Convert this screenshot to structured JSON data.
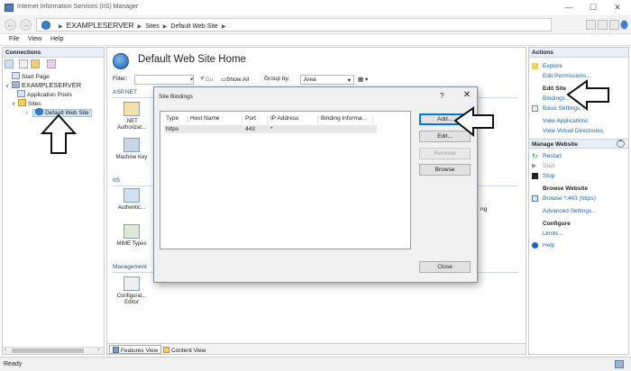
{
  "window": {
    "title": "Internet Information Services (IIS) Manager",
    "controls": [
      "—",
      "☐",
      "✕"
    ]
  },
  "address": {
    "server": "EXAMPLESERVER",
    "sites": "Sites",
    "site": "Default Web Site"
  },
  "menu": [
    "File",
    "View",
    "Help"
  ],
  "connections": {
    "header": "Connections",
    "tree": {
      "start_page": "Start Page",
      "server": "EXAMPLESERVER",
      "app_pools": "Application Pools",
      "sites": "Sites",
      "default_site": "Default Web Site"
    }
  },
  "center": {
    "title": "Default Web Site Home",
    "filter_label": "Filter:",
    "go_label": "Go",
    "show_all": "Show All",
    "group_by_label": "Group by:",
    "group_by_value": "Area",
    "sections": [
      "ASP.NET",
      "IIS",
      "Management"
    ],
    "features": {
      "net_auth": ".NET Authorizat...",
      "machine_key": "Machine Key",
      "authentication": "Authentic...",
      "mime_types": "MIME Types",
      "config_editor": "Configurat... Editor"
    },
    "tabs": {
      "features_view": "Features View",
      "content_view": "Content View"
    }
  },
  "dialog": {
    "title": "Site Bindings",
    "help": "?",
    "close": "✕",
    "columns": [
      "Type",
      "Host Name",
      "Port",
      "IP Address",
      "Binding Informa..."
    ],
    "rows": [
      {
        "type": "https",
        "host": "",
        "port": "443",
        "ip": "*",
        "info": ""
      }
    ],
    "buttons": {
      "add": "Add...",
      "edit": "Edit...",
      "remove": "Remove",
      "browse": "Browse",
      "close": "Close"
    }
  },
  "actions": {
    "header": "Actions",
    "explore": "Explore",
    "edit_permissions": "Edit Permissions...",
    "edit_site_header": "Edit Site",
    "bindings": "Bindings...",
    "basic_settings": "Basic Settings...",
    "view_applications": "View Applications",
    "view_virtual_dirs": "View Virtual Directories",
    "manage_website": "Manage Website",
    "restart": "Restart",
    "start": "Start",
    "stop": "Stop",
    "browse_website": "Browse Website",
    "browse_443": "Browse *:443 (https)",
    "advanced_settings": "Advanced Settings...",
    "configure": "Configure",
    "limits": "Limits...",
    "help": "Help"
  },
  "status": {
    "text": "Ready"
  },
  "colors": {
    "link": "#1a66c2",
    "pane_header": "#e7eef7",
    "selection": "#cce4f7",
    "focus_border": "#0078d7"
  }
}
